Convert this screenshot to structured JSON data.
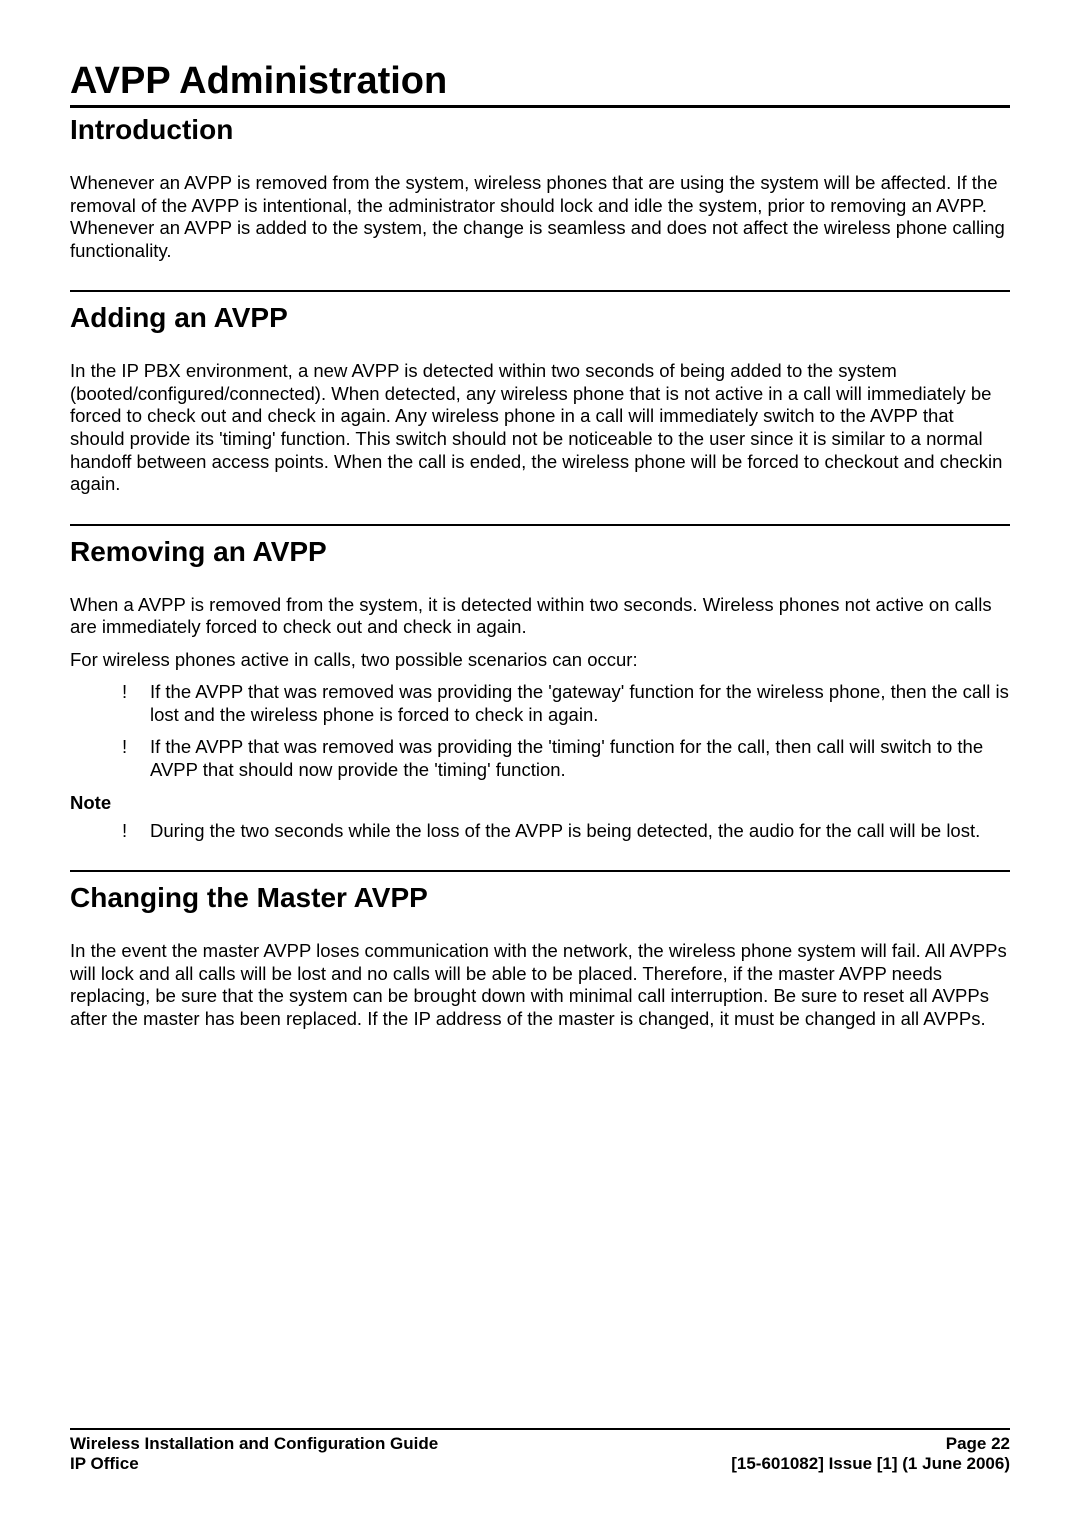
{
  "title": "AVPP Administration",
  "sections": {
    "intro": {
      "heading": "Introduction",
      "body": "Whenever an AVPP is removed from the system, wireless phones that are using the system will be affected. If the removal of the AVPP is intentional, the administrator should lock and idle the system, prior to removing an AVPP. Whenever an AVPP is added to the system, the change is seamless and does not affect the wireless phone calling functionality."
    },
    "adding": {
      "heading": "Adding an AVPP",
      "body": "In the IP PBX environment, a new AVPP is detected within two seconds of being added to the system (booted/configured/connected). When detected, any wireless phone that is not active in a call will immediately be forced to check out and check in again. Any wireless phone in a call will immediately switch to the AVPP that should provide its 'timing' function. This switch should not be noticeable to the user since it is similar to a normal handoff between access points. When the call is ended, the wireless phone will be forced to checkout and checkin again."
    },
    "removing": {
      "heading": "Removing an AVPP",
      "body1": "When a AVPP is removed from the system, it is detected within two seconds. Wireless phones not active on calls are immediately forced to check out and check in again.",
      "body2": "For wireless phones active in calls, two possible scenarios can occur:",
      "bullets": [
        "If the AVPP that was removed was providing the 'gateway' function for the wireless phone, then the call is lost and the wireless phone is forced to check in again.",
        "If the AVPP that was removed was providing the 'timing' function for the call, then call will switch to the AVPP that should now provide the 'timing' function."
      ],
      "noteLabel": "Note",
      "noteBullets": [
        "During the two seconds while the loss of the AVPP is being detected, the audio for the call will be lost."
      ]
    },
    "changing": {
      "heading": "Changing the Master AVPP",
      "body": "In the event the master AVPP loses communication with the network, the wireless phone system will fail. All AVPPs will lock and all calls will be lost and no calls will be able to be placed. Therefore, if the master AVPP needs replacing, be sure that the system can be brought down with minimal call interruption. Be sure to reset all AVPPs after the master has been replaced. If the IP address of the master is changed, it must be changed in all AVPPs."
    }
  },
  "footer": {
    "leftLine1": "Wireless Installation and Configuration Guide",
    "leftLine2": "IP Office",
    "rightLine1": "Page 22",
    "rightLine2": "[15-601082] Issue [1] (1 June 2006)"
  }
}
